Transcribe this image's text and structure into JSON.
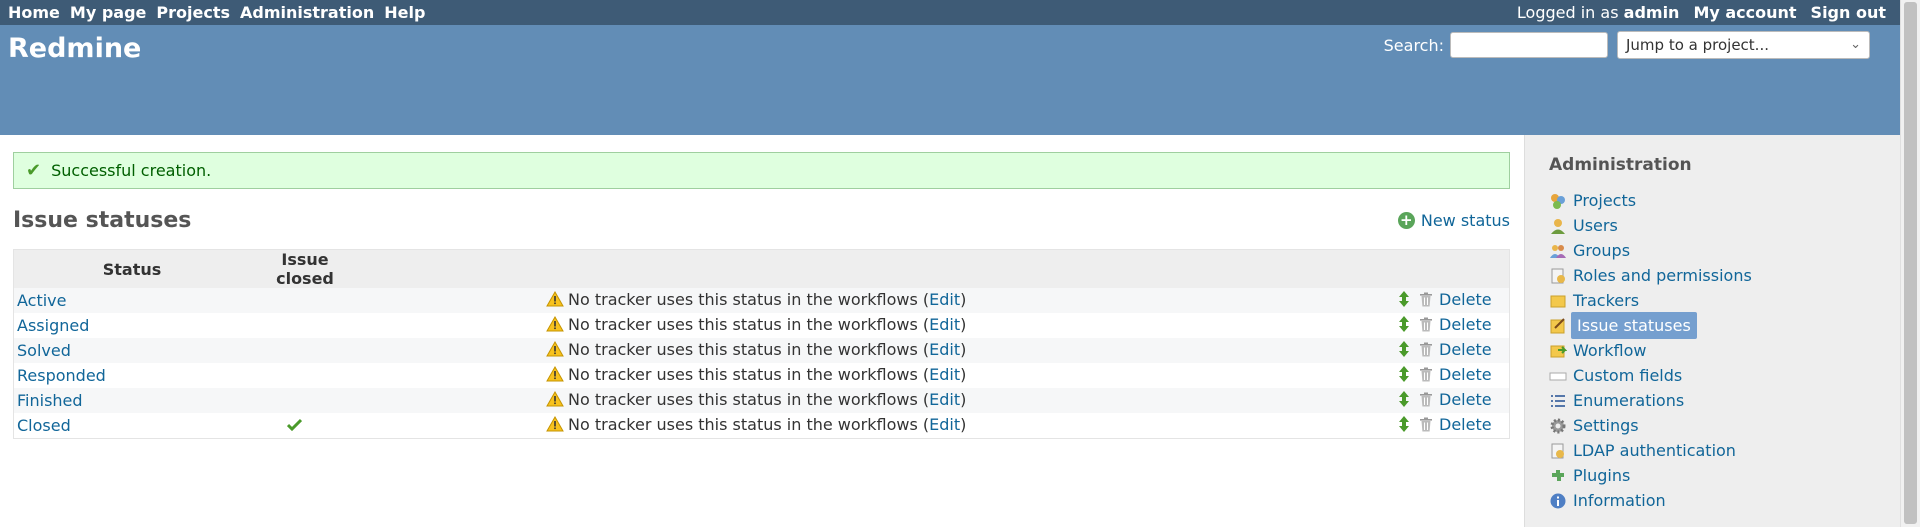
{
  "top_menu": {
    "left": [
      "Home",
      "My page",
      "Projects",
      "Administration",
      "Help"
    ],
    "logged_in_prefix": "Logged in as",
    "user": "admin",
    "right": [
      "My account",
      "Sign out"
    ]
  },
  "header": {
    "title": "Redmine",
    "search_label": "Search:",
    "search_value": "",
    "jump_label": "Jump to a project..."
  },
  "flash": {
    "message": "Successful creation."
  },
  "page": {
    "title": "Issue statuses",
    "new_status_label": "New status"
  },
  "table": {
    "headers": {
      "status": "Status",
      "issue_closed": "Issue closed"
    },
    "warning_text": "No tracker uses this status in the workflows (",
    "edit_label": "Edit",
    "warning_suffix": ")",
    "delete_label": "Delete",
    "rows": [
      {
        "name": "Active",
        "closed": false
      },
      {
        "name": "Assigned",
        "closed": false
      },
      {
        "name": "Solved",
        "closed": false
      },
      {
        "name": "Responded",
        "closed": false
      },
      {
        "name": "Finished",
        "closed": false
      },
      {
        "name": "Closed",
        "closed": true
      }
    ]
  },
  "sidebar": {
    "title": "Administration",
    "items": [
      {
        "label": "Projects",
        "icon": "projects-icon"
      },
      {
        "label": "Users",
        "icon": "user-icon"
      },
      {
        "label": "Groups",
        "icon": "group-icon"
      },
      {
        "label": "Roles and permissions",
        "icon": "roles-icon"
      },
      {
        "label": "Trackers",
        "icon": "tracker-icon"
      },
      {
        "label": "Issue statuses",
        "icon": "issue-status-icon",
        "selected": true
      },
      {
        "label": "Workflow",
        "icon": "workflow-icon"
      },
      {
        "label": "Custom fields",
        "icon": "custom-fields-icon"
      },
      {
        "label": "Enumerations",
        "icon": "list-icon"
      },
      {
        "label": "Settings",
        "icon": "gear-icon"
      },
      {
        "label": "LDAP authentication",
        "icon": "ldap-icon"
      },
      {
        "label": "Plugins",
        "icon": "plugin-icon"
      },
      {
        "label": "Information",
        "icon": "info-icon"
      }
    ]
  },
  "colors": {
    "top_menu_bg": "#3E5B76",
    "header_bg": "#628DB6",
    "link": "#169",
    "flash_bg": "#dfffdf",
    "selected_item_bg": "#759FCF"
  }
}
